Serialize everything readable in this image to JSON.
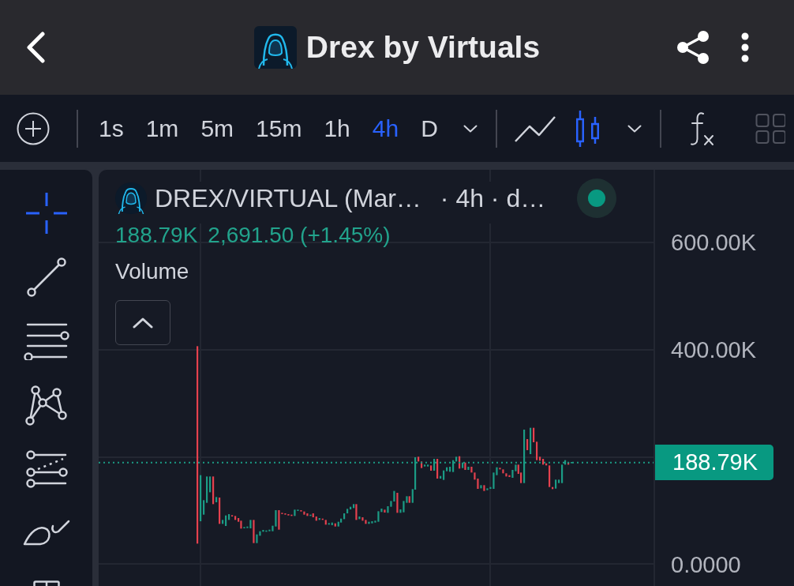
{
  "header": {
    "title": "Drex by Virtuals"
  },
  "toolbar": {
    "intervals": [
      {
        "label": "1s",
        "selected": false
      },
      {
        "label": "1m",
        "selected": false
      },
      {
        "label": "5m",
        "selected": false
      },
      {
        "label": "15m",
        "selected": false
      },
      {
        "label": "1h",
        "selected": false
      },
      {
        "label": "4h",
        "selected": true
      },
      {
        "label": "D",
        "selected": false
      }
    ],
    "chart_types": [
      {
        "kind": "line",
        "selected": false
      },
      {
        "kind": "candles",
        "selected": true
      }
    ]
  },
  "drawing_tools": [
    {
      "kind": "crosshair",
      "selected": true
    },
    {
      "kind": "trend_line",
      "selected": false
    },
    {
      "kind": "parallel_lines",
      "selected": false
    },
    {
      "kind": "pattern",
      "selected": false
    },
    {
      "kind": "fib_channel",
      "selected": false
    },
    {
      "kind": "brush",
      "selected": false
    },
    {
      "kind": "split_box",
      "selected": false
    }
  ],
  "chart": {
    "legend": {
      "symbol": "DREX/VIRTUAL (Mar…",
      "details": "· 4h · d…",
      "values": [
        "188.79K",
        "2,691.50 (+1.45%)"
      ],
      "indicator": "Volume"
    },
    "price_scale": {
      "ticks": [
        "600.00K",
        "400.00K",
        "0.0000"
      ],
      "last_price": "188.79K"
    }
  }
}
